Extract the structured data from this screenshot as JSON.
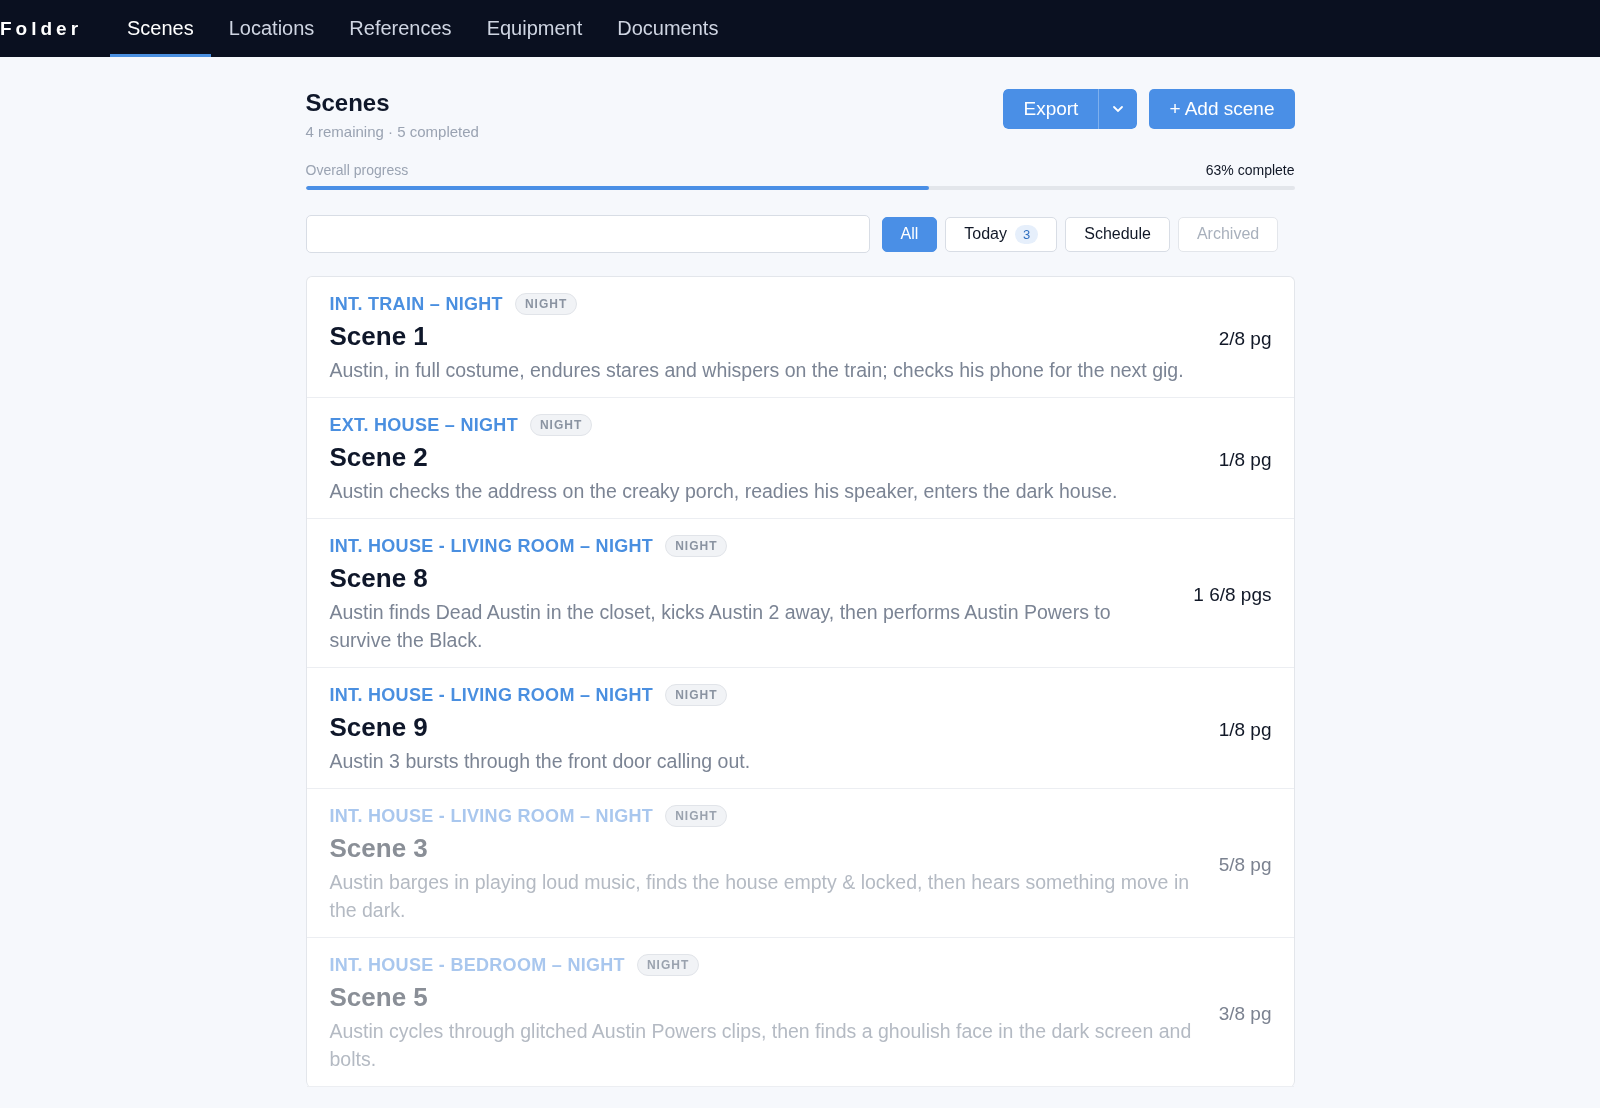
{
  "nav": {
    "brand": "Folder",
    "tabs": [
      {
        "label": "Scenes",
        "selected": true
      },
      {
        "label": "Locations",
        "selected": false
      },
      {
        "label": "References",
        "selected": false
      },
      {
        "label": "Equipment",
        "selected": false
      },
      {
        "label": "Documents",
        "selected": false
      }
    ]
  },
  "header": {
    "title": "Scenes",
    "subtitle": "4 remaining · 5 completed",
    "export_label": "Export",
    "add_label": "+ Add scene"
  },
  "progress": {
    "label": "Overall progress",
    "reading": "63% complete",
    "level": 0.63
  },
  "filters": [
    {
      "label": "All",
      "selected": true,
      "disabled": false
    },
    {
      "label": "Today",
      "count": "3",
      "selected": false,
      "disabled": false
    },
    {
      "label": "Schedule",
      "selected": false,
      "disabled": false
    },
    {
      "label": "Archived",
      "selected": false,
      "disabled": true
    }
  ],
  "scenes": [
    {
      "slug": "INT. TRAIN – NIGHT",
      "tag": "NIGHT",
      "title": "Scene 1",
      "summary": "Austin, in full costume, endures stares and whispers on the train; checks his phone for the next gig.",
      "length": "2/8 pg",
      "completed": false
    },
    {
      "slug": "EXT. HOUSE – NIGHT",
      "tag": "NIGHT",
      "title": "Scene 2",
      "summary": "Austin checks the address on the creaky porch, readies his speaker, enters the dark house.",
      "length": "1/8 pg",
      "completed": false
    },
    {
      "slug": "INT. HOUSE - LIVING ROOM – NIGHT",
      "tag": "NIGHT",
      "title": "Scene 8",
      "summary": "Austin finds Dead Austin in the closet, kicks Austin 2 away, then performs Austin Powers to survive the Black.",
      "length": "1 6/8 pgs",
      "completed": false
    },
    {
      "slug": "INT. HOUSE - LIVING ROOM – NIGHT",
      "tag": "NIGHT",
      "title": "Scene 9",
      "summary": "Austin 3 bursts through the front door calling out.",
      "length": "1/8 pg",
      "completed": false
    },
    {
      "slug": "INT. HOUSE - LIVING ROOM – NIGHT",
      "tag": "NIGHT",
      "title": "Scene 3",
      "summary": "Austin barges in playing loud music, finds the house empty & locked, then hears something move in the dark.",
      "length": "5/8 pg",
      "completed": true
    },
    {
      "slug": "INT. HOUSE - BEDROOM – NIGHT",
      "tag": "NIGHT",
      "title": "Scene 5",
      "summary": "Austin cycles through glitched Austin Powers clips, then finds a ghoulish face in the dark screen and bolts.",
      "length": "3/8 pg",
      "completed": true
    }
  ]
}
